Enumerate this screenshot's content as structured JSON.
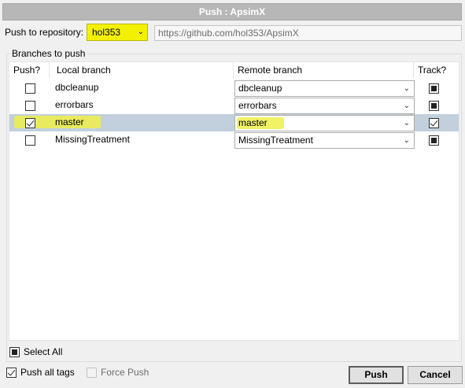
{
  "window": {
    "title": "Push :  ApsimX"
  },
  "repo": {
    "label": "Push to repository:",
    "selected": "hol353",
    "url": "https://github.com/hol353/ApsimX"
  },
  "branches": {
    "group_title": "Branches to push",
    "columns": {
      "push": "Push?",
      "local": "Local branch",
      "remote": "Remote branch",
      "track": "Track?"
    },
    "rows": [
      {
        "local": "dbcleanup",
        "remote": "dbcleanup",
        "push": false,
        "track": true
      },
      {
        "local": "errorbars",
        "remote": "errorbars",
        "push": false,
        "track": true
      },
      {
        "local": "master",
        "remote": "master",
        "push": true,
        "track": true
      },
      {
        "local": "MissingTreatment",
        "remote": "MissingTreatment",
        "push": false,
        "track": true
      }
    ]
  },
  "select_all": {
    "label": "Select All"
  },
  "options": {
    "push_all_tags": "Push all tags",
    "force_push": "Force Push"
  },
  "buttons": {
    "push": "Push",
    "cancel": "Cancel"
  },
  "colors": {
    "highlight": "#f4f100",
    "selected_row": "#c2d0dd"
  }
}
